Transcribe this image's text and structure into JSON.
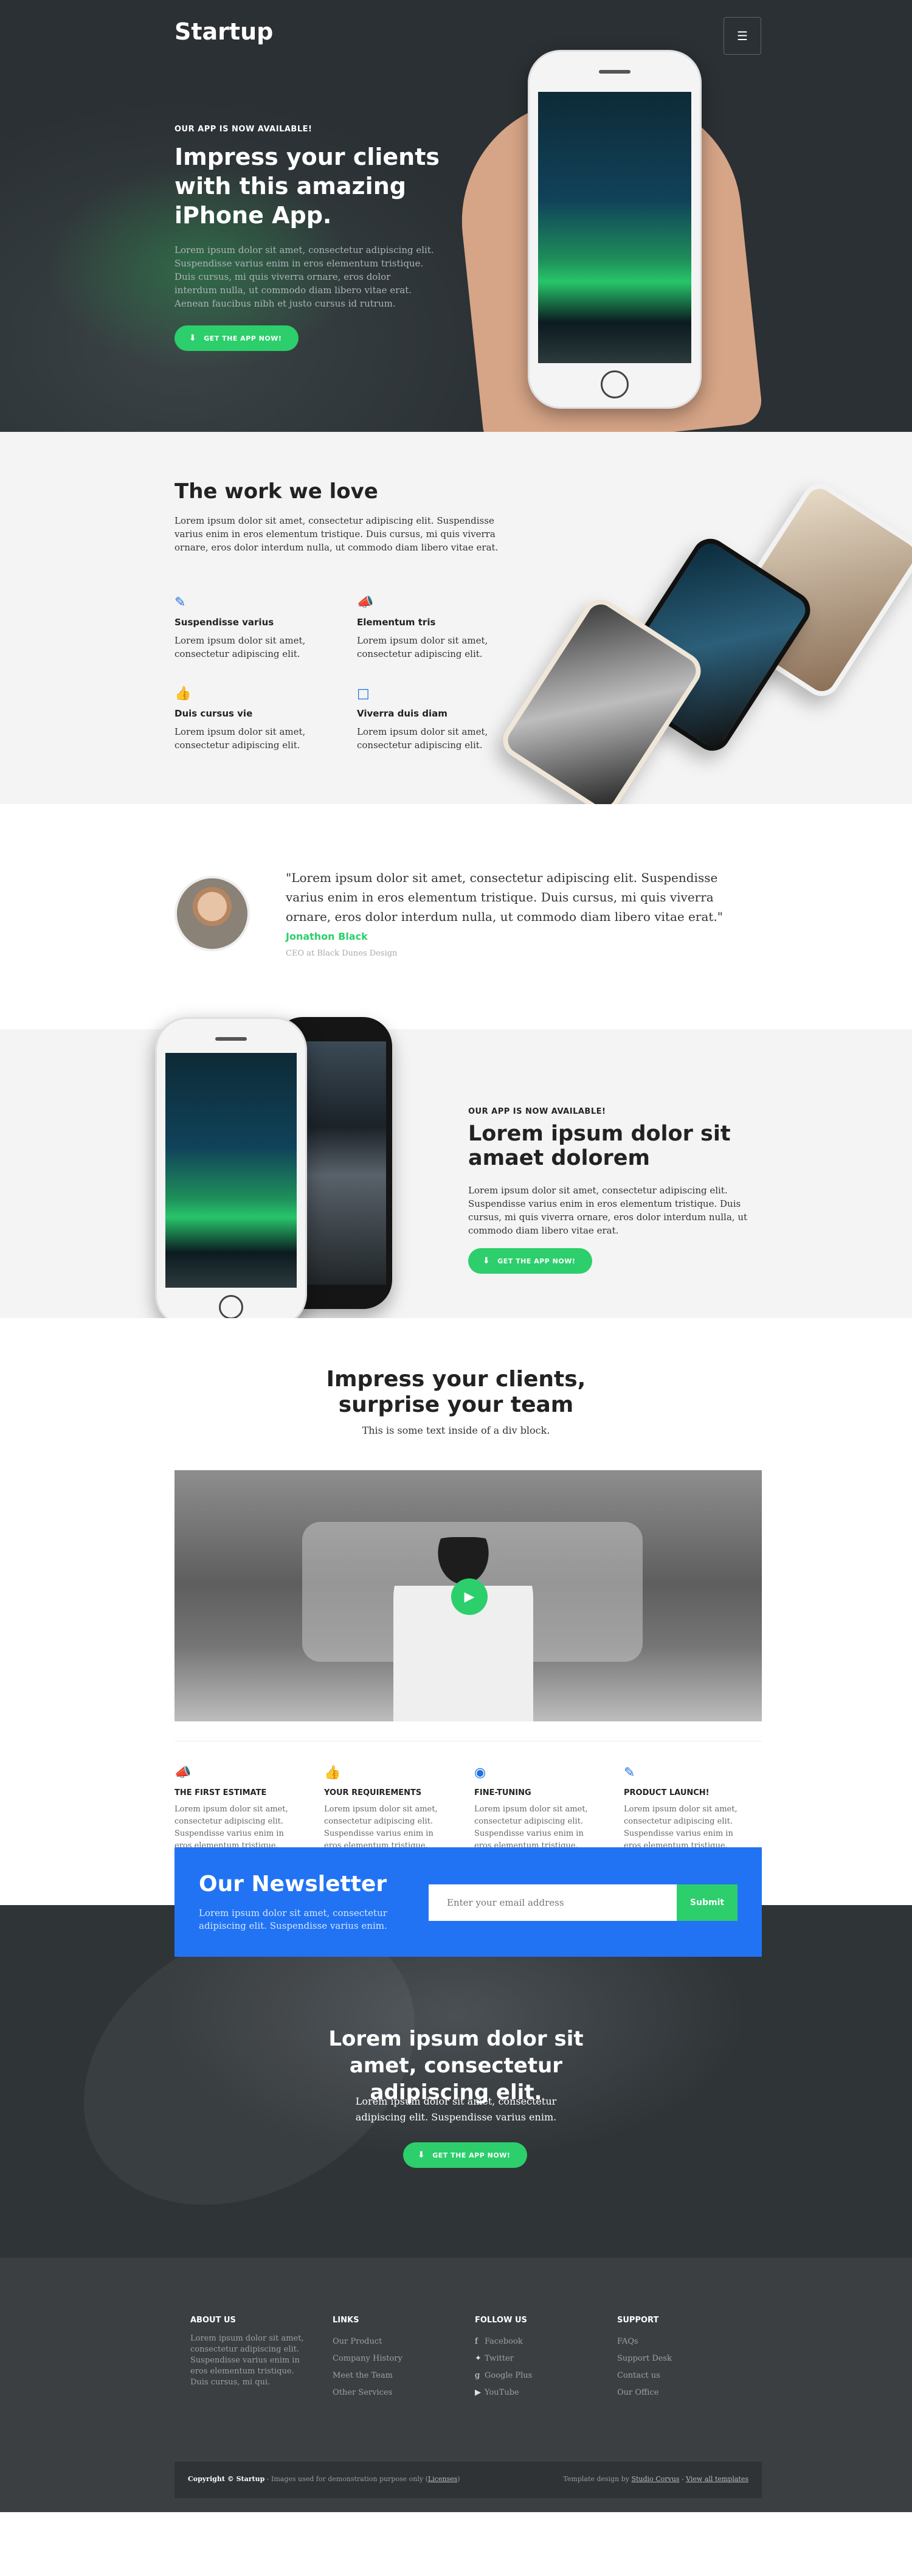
{
  "hero": {
    "brand": "Startup",
    "menu_icon": "hamburger-icon",
    "kicker": "OUR APP IS NOW AVAILABLE!",
    "headline": "Impress your clients with this amazing iPhone App.",
    "lead": "Lorem ipsum dolor sit amet, consectetur adipiscing elit. Suspendisse varius enim in eros elementum tristique. Duis cursus, mi quis viverra ornare, eros dolor interdum nulla, ut commodo diam libero vitae erat. Aenean faucibus nibh et justo cursus id rutrum.",
    "cta": "GET THE APP NOW!"
  },
  "work": {
    "title": "The work we love",
    "intro": "Lorem ipsum dolor sit amet, consectetur adipiscing elit. Suspendisse varius enim in eros elementum tristique. Duis cursus, mi quis viverra ornare, eros dolor interdum nulla, ut commodo diam libero vitae erat.",
    "features": [
      {
        "icon": "pencil-icon",
        "title": "Suspendisse varius",
        "text": "Lorem ipsum dolor sit amet, consectetur adipiscing elit."
      },
      {
        "icon": "megaphone-icon",
        "title": "Elementum tris",
        "text": "Lorem ipsum dolor sit amet, consectetur adipiscing elit."
      },
      {
        "icon": "thumbs-up-icon",
        "title": "Duis cursus vie",
        "text": "Lorem ipsum dolor sit amet, consectetur adipiscing elit."
      },
      {
        "icon": "monitor-icon",
        "title": "Viverra duis diam",
        "text": "Lorem ipsum dolor sit amet, consectetur adipiscing elit."
      }
    ]
  },
  "testimonial": {
    "quote": "\"Lorem ipsum dolor sit amet, consectetur adipiscing elit. Suspendisse varius enim in eros elementum tristique. Duis cursus, mi quis viverra ornare, eros dolor interdum nulla, ut commodo diam libero vitae erat.\"",
    "name": "Jonathon Black",
    "role": "CEO at Black Dunes Design"
  },
  "app2": {
    "kicker": "OUR APP IS NOW AVAILABLE!",
    "title": "Lorem ipsum dolor sit amaet dolorem",
    "lead": "Lorem ipsum dolor sit amet, consectetur adipiscing elit. Suspendisse varius enim in eros elementum tristique. Duis cursus, mi quis viverra ornare, eros dolor interdum nulla, ut commodo diam libero vitae erat.",
    "cta": "GET THE APP NOW!"
  },
  "impress": {
    "title": "Impress your clients, surprise your team",
    "subtitle": "This is some text inside of a div block."
  },
  "steps": [
    {
      "icon": "megaphone-icon",
      "title": "THE FIRST ESTIMATE",
      "text": "Lorem ipsum dolor sit amet, consectetur adipiscing elit. Suspendisse varius enim in eros elementum tristique. Duis cursus, mi quis viverra."
    },
    {
      "icon": "thumbs-up-icon",
      "title": "YOUR REQUIREMENTS",
      "text": "Lorem ipsum dolor sit amet, consectetur adipiscing elit. Suspendisse varius enim in eros elementum tristique. Duis cursus, mi quis viverra."
    },
    {
      "icon": "camera-icon",
      "title": "FINE-TUNING",
      "text": "Lorem ipsum dolor sit amet, consectetur adipiscing elit. Suspendisse varius enim in eros elementum tristique. Duis cursus, mi quis viverra."
    },
    {
      "icon": "pencil-icon",
      "title": "PRODUCT LAUNCH!",
      "text": "Lorem ipsum dolor sit amet, consectetur adipiscing elit. Suspendisse varius enim in eros elementum tristique. Duis cursus, mi quis viverra."
    }
  ],
  "newsletter": {
    "title": "Our Newsletter",
    "text": "Lorem ipsum dolor sit amet, consectetur adipiscing elit. Suspendisse varius enim.",
    "placeholder": "Enter your email address",
    "submit": "Submit"
  },
  "cta": {
    "title": "Lorem ipsum dolor sit amet, consectetur adipiscing elit.",
    "lead": "Lorem ipsum dolor sit amet, consectetur adipiscing elit. Suspendisse varius enim.",
    "button": "GET THE APP NOW!"
  },
  "footer": {
    "about_title": "ABOUT US",
    "about_text": "Lorem ipsum dolor sit amet, consectetur adipiscing elit. Suspendisse varius enim in eros elementum tristique. Duis cursus, mi qui.",
    "links_title": "LINKS",
    "links": [
      "Our Product",
      "Company History",
      "Meet the Team",
      "Other Services"
    ],
    "follow_title": "FOLLOW US",
    "follow": [
      {
        "icon": "facebook-icon",
        "label": "Facebook"
      },
      {
        "icon": "twitter-icon",
        "label": "Twitter"
      },
      {
        "icon": "google-plus-icon",
        "label": "Google Plus"
      },
      {
        "icon": "youtube-icon",
        "label": "YouTube"
      }
    ],
    "support_title": "SUPPORT",
    "support": [
      "FAQs",
      "Support Desk",
      "Contact us",
      "Our Office"
    ],
    "copyright_bold": "Copyright © Startup",
    "copyright_rest": " - Images used for demonstration purpose only (",
    "licenses": "Licenses",
    "copyright_end": ")",
    "credit_prefix": "Template design by ",
    "credit_link": "Studio Corvus",
    "credit_sep": " - ",
    "credit_link2": "View all templates"
  },
  "colors": {
    "accent_green": "#2ccf6b",
    "accent_blue": "#2173f4",
    "dark": "#2f3437"
  }
}
